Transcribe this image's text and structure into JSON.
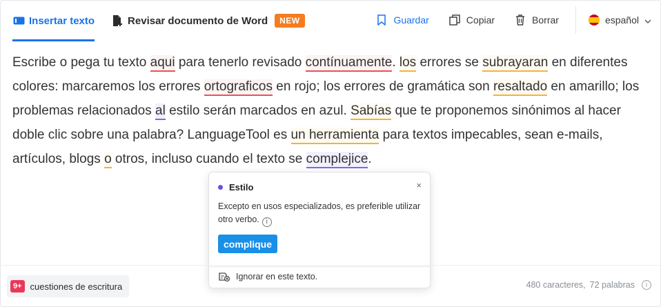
{
  "tabs": {
    "insert": "Insertar texto",
    "review": "Revisar documento de Word",
    "new_badge": "NEW"
  },
  "actions": {
    "save": "Guardar",
    "copy": "Copiar",
    "delete": "Borrar",
    "language": "español"
  },
  "editor": {
    "t1": "Escribe o pega tu texto ",
    "e1": "aqui",
    "t2": " para tenerlo revisado ",
    "e2": "contínuamente",
    "t3": ". ",
    "e3": "los",
    "t4": " errores se ",
    "e4": "subrayaran",
    "t5": " en diferentes colores: marcaremos los errores ",
    "e5": "ortograficos",
    "t6": " en rojo; los errores de gramática son ",
    "e6": "resaltado",
    "t7": " en amarillo; los problemas relacionados ",
    "e7": "al",
    "t8": " estilo serán marcados en azul. ",
    "e8": "Sabías",
    "t9": " que te proponemos sinónimos al hacer doble clic sobre una palabra? LanguageTool es ",
    "e9": "un herramienta",
    "t10": " para textos impecables, sean e-mails, artículos, blogs ",
    "e10": "o",
    "t11": " otros, incluso cuando el texto se ",
    "e11": "complejice",
    "t12": "."
  },
  "popup": {
    "category": "Estilo",
    "message": "Excepto en usos especializados, es preferible utilizar otro verbo.",
    "suggestion": "complique",
    "ignore": "Ignorar en este texto.",
    "close": "×"
  },
  "footer": {
    "issue_count": "9+",
    "issue_label": "cuestiones de escritura",
    "characters": "480 caracteres,",
    "words": "72 palabras"
  },
  "colors": {
    "accent": "#1a73e8",
    "spelling": "#e8505b",
    "grammar": "#f3b23c",
    "style": "#7b68ee",
    "badge_new": "#f57c1f",
    "issue_badge": "#e8395a"
  }
}
